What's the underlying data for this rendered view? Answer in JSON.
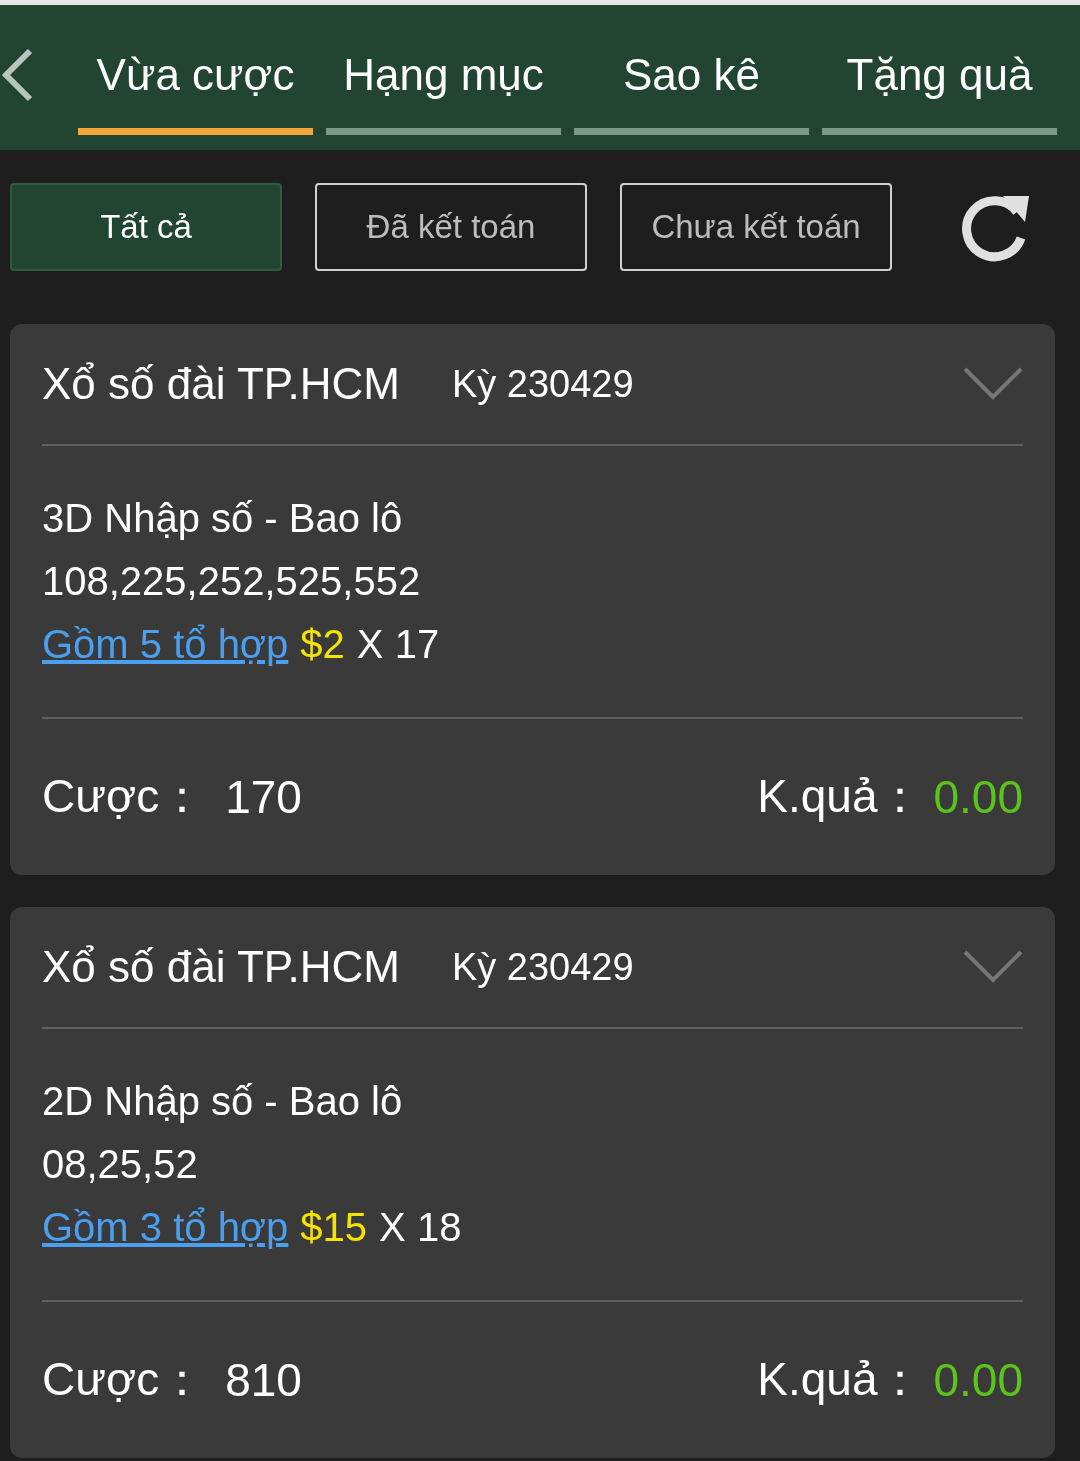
{
  "header": {
    "tabs": [
      {
        "label": "Vừa cược",
        "selected": true
      },
      {
        "label": "Hạng mục",
        "selected": false
      },
      {
        "label": "Sao kê",
        "selected": false
      },
      {
        "label": "Tặng quà",
        "selected": false
      }
    ]
  },
  "filters": [
    {
      "label": "Tất cả",
      "selected": true
    },
    {
      "label": "Đã kết toán",
      "selected": false
    },
    {
      "label": "Chưa kết toán",
      "selected": false
    }
  ],
  "bets": [
    {
      "lottery": "Xổ số đài TP.HCM",
      "period": "Kỳ 230429",
      "bet_type": "3D Nhập số - Bao lô",
      "numbers": "108,225,252,525,552",
      "combos_link": "Gồm 5 tổ hợp",
      "unit_price": "$2",
      "multiplier": "X 17",
      "stake_label": "Cược：",
      "stake": "170",
      "result_label": "K.quả：",
      "result": "0.00"
    },
    {
      "lottery": "Xổ số đài TP.HCM",
      "period": "Kỳ 230429",
      "bet_type": "2D Nhập số - Bao lô",
      "numbers": "08,25,52",
      "combos_link": "Gồm 3 tổ hợp",
      "unit_price": "$15",
      "multiplier": "X 18",
      "stake_label": "Cược：",
      "stake": "810",
      "result_label": "K.quả：",
      "result": "0.00"
    }
  ]
}
